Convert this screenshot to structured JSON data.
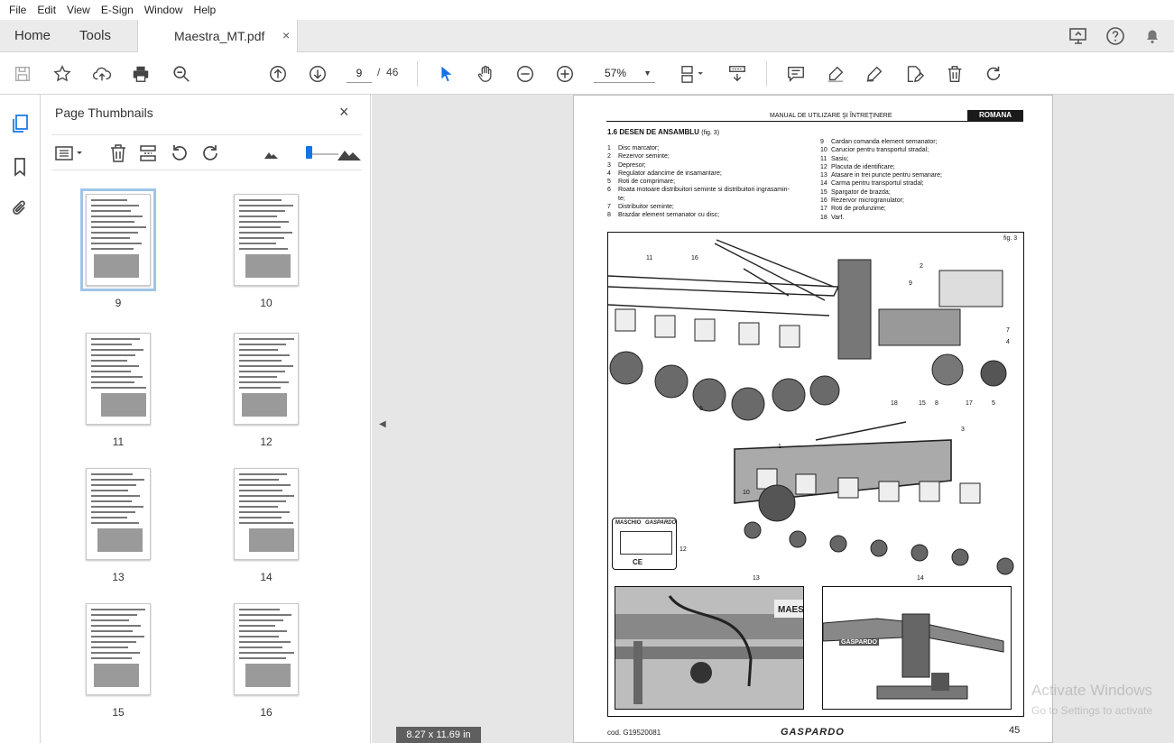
{
  "menu": [
    "File",
    "Edit",
    "View",
    "E-Sign",
    "Window",
    "Help"
  ],
  "tabs": {
    "home": "Home",
    "tools": "Tools",
    "document": "Maestra_MT.pdf",
    "close": "×"
  },
  "toolbar": {
    "page_current": "9",
    "page_separator": "/",
    "page_total": "46",
    "zoom": "57%",
    "zoom_caret": "▼"
  },
  "panel": {
    "title": "Page Thumbnails",
    "close": "×",
    "thumbnails": [
      {
        "num": "9",
        "selected": true
      },
      {
        "num": "10"
      },
      {
        "num": "11"
      },
      {
        "num": "12"
      },
      {
        "num": "13"
      },
      {
        "num": "14"
      },
      {
        "num": "15"
      },
      {
        "num": "16"
      }
    ]
  },
  "page_size_badge": "8.27 x 11.69 in",
  "collapse_arrow": "◀",
  "document_page": {
    "header_manual": "MANUAL DE UTILIZARE ŞI ÎNTREŢINERE",
    "header_lang": "ROMANA",
    "section_title": "1.6  DESEN DE ANSAMBLU",
    "section_fig": "(fig. 3)",
    "list_left": [
      {
        "n": "1",
        "t": "Disc marcator;"
      },
      {
        "n": "2",
        "t": "Rezervor seminte;"
      },
      {
        "n": "3",
        "t": "Depresor;"
      },
      {
        "n": "4",
        "t": "Regulator adancime de insamantare;"
      },
      {
        "n": "5",
        "t": "Roti de comprimare;"
      },
      {
        "n": "6",
        "t": "Roata motoare distribuitori seminte si distribuitori ingrasamin-"
      },
      {
        "n": "",
        "t": "te;"
      },
      {
        "n": "7",
        "t": "Distribuitor seminte;"
      },
      {
        "n": "8",
        "t": "Brazdar element semanator cu disc;"
      }
    ],
    "list_right": [
      {
        "n": "9",
        "t": "Cardan comanda element semanator;"
      },
      {
        "n": "10",
        "t": "Carucior pentru transportul stradal;"
      },
      {
        "n": "11",
        "t": "Sasiu;"
      },
      {
        "n": "12",
        "t": "Placuta de identificare;"
      },
      {
        "n": "13",
        "t": "Atasare in trei puncte pentru semanare;"
      },
      {
        "n": "14",
        "t": "Carma pentru transportul stradal;"
      },
      {
        "n": "15",
        "t": "Spargator de brazda;"
      },
      {
        "n": "16",
        "t": "Rezervor microgranulator;"
      },
      {
        "n": "17",
        "t": "Roti de profunzime;"
      },
      {
        "n": "18",
        "t": "Varf."
      }
    ],
    "fig_label": "fig. 3",
    "callouts": [
      "11",
      "16",
      "2",
      "9",
      "7",
      "4",
      "18",
      "15",
      "8",
      "17",
      "5",
      "6",
      "1",
      "3",
      "10",
      "12",
      "13",
      "14"
    ],
    "plate_brand": "MASCHIO",
    "plate_brand2": "GASPARDO",
    "plate_ce": "CE",
    "frame_label": "GASPARDO",
    "frame_label2": "MAES",
    "footer_cod": "cod.   G19520081",
    "footer_brand": "GASPARDO",
    "footer_page": "45"
  },
  "watermark": {
    "line1": "Activate Windows",
    "line2": "Go to Settings to activate"
  }
}
